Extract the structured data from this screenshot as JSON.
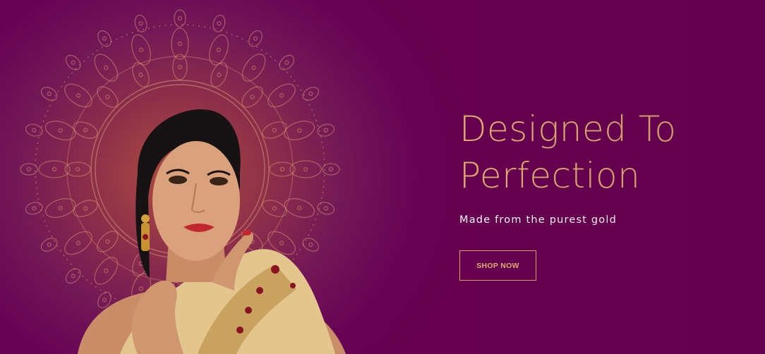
{
  "hero": {
    "headline_line1": "Designed To",
    "headline_line2": "Perfection",
    "subtitle": "Made from the purest gold",
    "cta_label": "SHOP NOW"
  },
  "colors": {
    "background": "#66004f",
    "glow": "#b0503f",
    "gold": "#dfae72",
    "subtitle": "#ffffff"
  },
  "icons": {
    "mandala": "mandala-ornament-icon",
    "model": "model-portrait-image"
  }
}
